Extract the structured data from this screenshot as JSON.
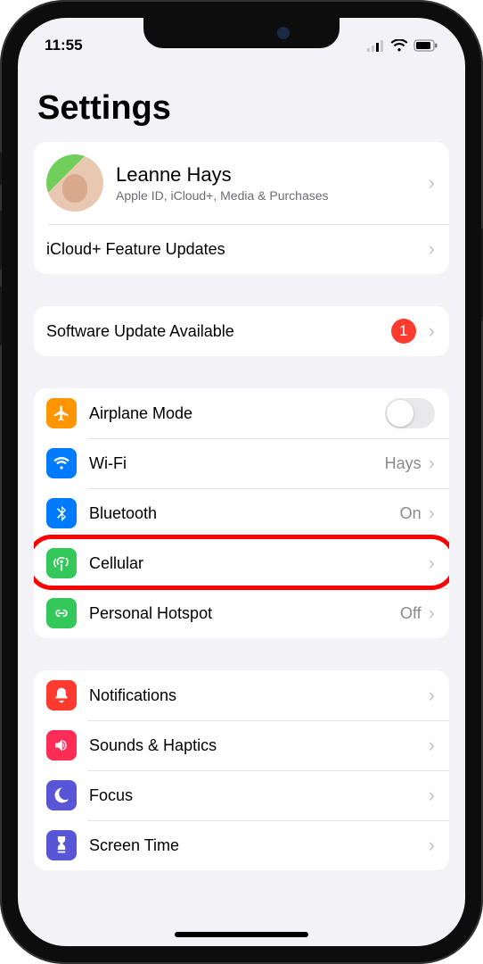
{
  "status": {
    "time": "11:55"
  },
  "title": "Settings",
  "profile": {
    "name": "Leanne Hays",
    "subtitle": "Apple ID, iCloud+, Media & Purchases"
  },
  "icloud_updates_label": "iCloud+ Feature Updates",
  "software_update": {
    "label": "Software Update Available",
    "badge": "1"
  },
  "conn": {
    "airplane": "Airplane Mode",
    "wifi": {
      "label": "Wi-Fi",
      "value": "Hays"
    },
    "bluetooth": {
      "label": "Bluetooth",
      "value": "On"
    },
    "cellular": "Cellular",
    "hotspot": {
      "label": "Personal Hotspot",
      "value": "Off"
    }
  },
  "gen": {
    "notifications": "Notifications",
    "sounds": "Sounds & Haptics",
    "focus": "Focus",
    "screentime": "Screen Time"
  }
}
